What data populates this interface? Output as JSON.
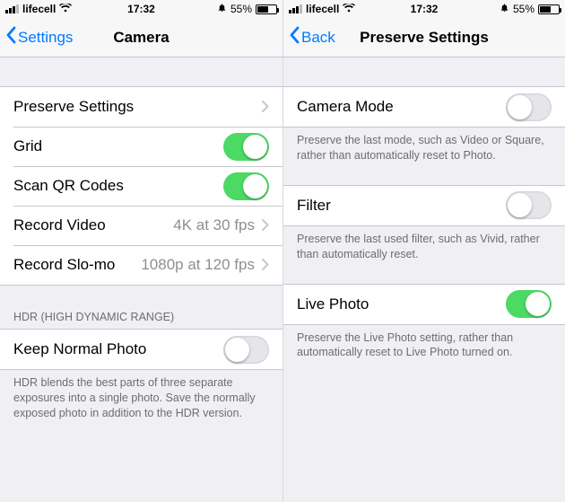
{
  "statusbar": {
    "carrier": "lifecell",
    "time": "17:32",
    "battery_pct": "55%"
  },
  "left": {
    "back_label": "Settings",
    "title": "Camera",
    "rows": {
      "preserve": "Preserve Settings",
      "grid": "Grid",
      "qr": "Scan QR Codes",
      "record_video_label": "Record Video",
      "record_video_value": "4K at 30 fps",
      "record_slomo_label": "Record Slo-mo",
      "record_slomo_value": "1080p at 120 fps"
    },
    "hdr_header": "HDR (High Dynamic Range)",
    "keep_normal": "Keep Normal Photo",
    "hdr_footer": "HDR blends the best parts of three separate exposures into a single photo. Save the normally exposed photo in addition to the HDR version."
  },
  "right": {
    "back_label": "Back",
    "title": "Preserve Settings",
    "camera_mode": "Camera Mode",
    "camera_mode_footer": "Preserve the last mode, such as Video or Square, rather than automatically reset to Photo.",
    "filter": "Filter",
    "filter_footer": "Preserve the last used filter, such as Vivid, rather than automatically reset.",
    "live_photo": "Live Photo",
    "live_photo_footer": "Preserve the Live Photo setting, rather than automatically reset to Live Photo turned on."
  }
}
